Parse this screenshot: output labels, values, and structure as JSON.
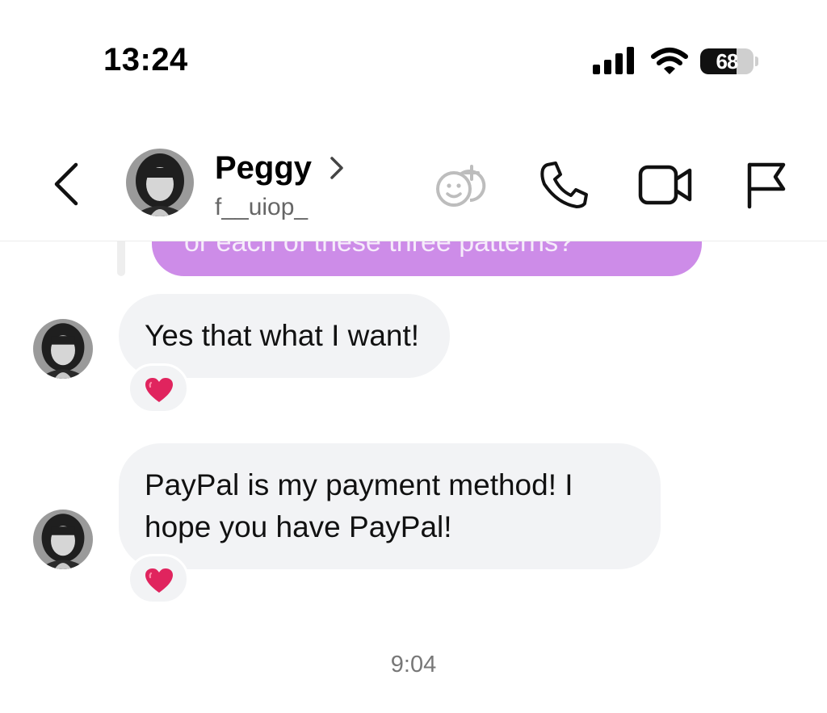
{
  "status_bar": {
    "time": "13:24",
    "battery_level": "68",
    "battery_fraction": 0.68,
    "icons": [
      "signal-icon",
      "wifi-icon",
      "battery-icon"
    ]
  },
  "header": {
    "contact_name": "Peggy",
    "contact_handle": "f__uiop_",
    "icons": [
      "back-chevron-icon",
      "chevron-right-icon",
      "add-sticker-icon",
      "phone-icon",
      "video-camera-icon",
      "flag-icon"
    ]
  },
  "messages": {
    "previous_message_partial": "or each of these three patterns?",
    "items": [
      {
        "text": "Yes that what I want!",
        "reaction": "❤️"
      },
      {
        "line1": "PayPal is my payment method! I",
        "line2": "hope you have PayPal!",
        "reaction": "❤️"
      }
    ],
    "timestamp": "9:04"
  },
  "colors": {
    "own_bubble": "#cd8ce8",
    "received_bubble": "#f2f3f5",
    "reaction_heart": "#e0245e"
  }
}
